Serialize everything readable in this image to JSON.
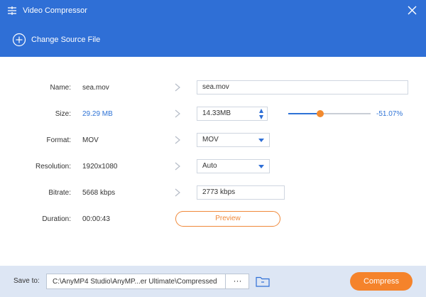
{
  "window": {
    "title": "Video Compressor"
  },
  "toolbar": {
    "change_source_label": "Change Source File"
  },
  "fields": {
    "name": {
      "label": "Name:",
      "value": "sea.mov",
      "output": "sea.mov"
    },
    "size": {
      "label": "Size:",
      "value": "29.29 MB",
      "output": "14.33MB",
      "percent": "-51.07%",
      "slider_level": 0.385
    },
    "format": {
      "label": "Format:",
      "value": "MOV",
      "selected": "MOV"
    },
    "resolution": {
      "label": "Resolution:",
      "value": "1920x1080",
      "selected": "Auto"
    },
    "bitrate": {
      "label": "Bitrate:",
      "value": "5668 kbps",
      "output": "2773 kbps"
    },
    "duration": {
      "label": "Duration:",
      "value": "00:00:43"
    }
  },
  "preview_label": "Preview",
  "footer": {
    "save_to_label": "Save to:",
    "path": "C:\\AnyMP4 Studio\\AnyMP...er Ultimate\\Compressed",
    "browse_label": "···",
    "compress_label": "Compress"
  },
  "colors": {
    "accent_blue": "#2f6fd6",
    "accent_orange": "#f5832b",
    "footer_bg": "#dde6f4"
  },
  "icons": [
    "app-icon",
    "close-icon",
    "add-circle-icon",
    "chevron-right-icon",
    "dropdown-arrow-icon",
    "spin-up-icon",
    "spin-down-icon",
    "folder-icon"
  ]
}
